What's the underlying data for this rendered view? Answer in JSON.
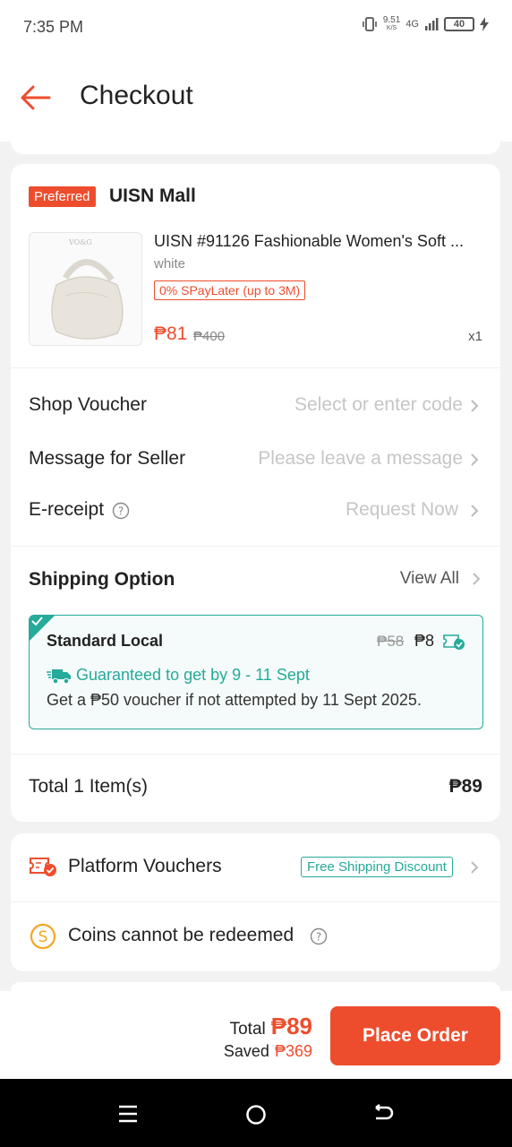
{
  "status_bar": {
    "time": "7:35 PM",
    "speed_value": "9.51",
    "speed_unit": "K/S",
    "network": "4G",
    "battery": "40"
  },
  "header": {
    "title": "Checkout",
    "back_icon": "back-arrow-icon"
  },
  "shop": {
    "badge": "Preferred",
    "name": "UISN Mall",
    "product": {
      "name": "UISN #91126 Fashionable Women's Soft ...",
      "variant": "white",
      "promo_tag": "0% SPayLater (up to 3M)",
      "price": "₱81",
      "original_price": "₱400",
      "quantity": "x1"
    },
    "shop_voucher": {
      "label": "Shop Voucher",
      "placeholder": "Select or enter code"
    },
    "message": {
      "label": "Message for Seller",
      "placeholder": "Please leave a message"
    },
    "ereceipt": {
      "label": "E-receipt",
      "value": "Request Now"
    },
    "shipping": {
      "title": "Shipping Option",
      "view_all": "View All",
      "option_name": "Standard Local",
      "old_price": "₱58",
      "price": "₱8",
      "guarantee": "Guaranteed to get by 9 - 11 Sept",
      "voucher_note": "Get a ₱50 voucher if not attempted by 11 Sept 2025."
    },
    "total": {
      "label": "Total 1 Item(s)",
      "value": "₱89"
    }
  },
  "vouchers": {
    "platform_label": "Platform Vouchers",
    "platform_tag": "Free Shipping Discount",
    "coins_label": "Coins cannot be redeemed"
  },
  "footer": {
    "total_label": "Total",
    "total_value": "₱89",
    "saved_label": "Saved",
    "saved_value": "₱369",
    "place_order": "Place Order"
  },
  "colors": {
    "accent": "#ee4d2d",
    "teal": "#26aa99",
    "coin": "#f5a623"
  }
}
